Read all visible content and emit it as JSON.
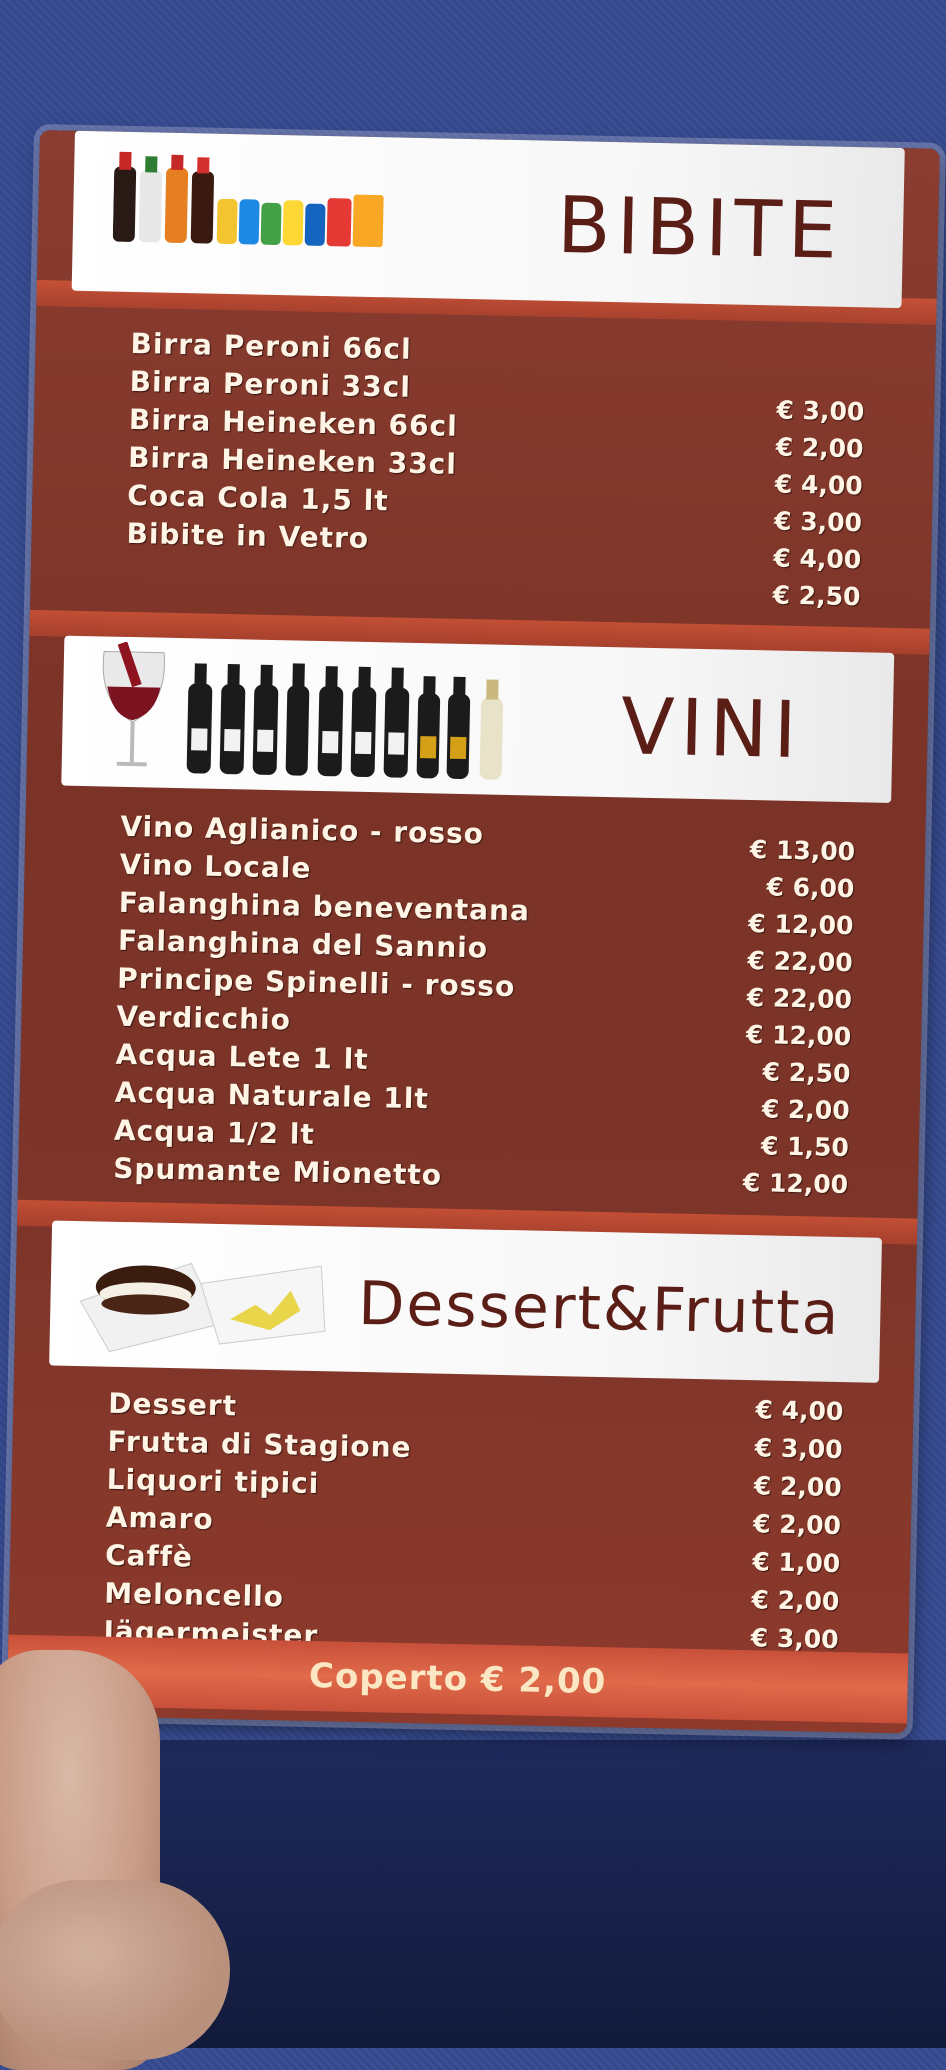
{
  "sections": [
    {
      "title": "BIBITE",
      "items": [
        {
          "name": "Birra Peroni 66cl",
          "price": "€ 3,00"
        },
        {
          "name": "Birra Peroni 33cl",
          "price": "€ 2,00"
        },
        {
          "name": "Birra Heineken 66cl",
          "price": "€ 4,00"
        },
        {
          "name": "Birra Heineken 33cl",
          "price": "€ 3,00"
        },
        {
          "name": "Coca Cola 1,5 lt",
          "price": "€ 4,00"
        },
        {
          "name": "Bibite in Vetro",
          "price": "€ 2,50"
        }
      ]
    },
    {
      "title": "VINI",
      "items": [
        {
          "name": "Vino Aglianico - rosso",
          "price": "€ 13,00"
        },
        {
          "name": "Vino Locale",
          "price": "€  6,00"
        },
        {
          "name": "Falanghina beneventana",
          "price": "€ 12,00"
        },
        {
          "name": "Falanghina del Sannio",
          "price": "€ 22,00"
        },
        {
          "name": "Principe Spinelli - rosso",
          "price": "€ 22,00"
        },
        {
          "name": "Verdicchio",
          "price": "€ 12,00"
        },
        {
          "name": "Acqua Lete 1 lt",
          "price": "€  2,50"
        },
        {
          "name": "Acqua Naturale 1lt",
          "price": "€  2,00"
        },
        {
          "name": "Acqua 1/2 lt",
          "price": "€  1,50"
        },
        {
          "name": "Spumante Mionetto",
          "price": "€ 12,00"
        }
      ]
    },
    {
      "title": "Dessert&Frutta",
      "items": [
        {
          "name": "Dessert",
          "price": "€ 4,00"
        },
        {
          "name": "Frutta di Stagione",
          "price": "€ 3,00"
        },
        {
          "name": "Liquori tipici",
          "price": "€ 2,00"
        },
        {
          "name": "Amaro",
          "price": "€ 2,00"
        },
        {
          "name": "Caffè",
          "price": "€ 1,00"
        },
        {
          "name": "Meloncello",
          "price": "€ 2,00"
        },
        {
          "name": "Jägermeister",
          "price": "€ 3,00"
        }
      ]
    }
  ],
  "footer": {
    "coperto": "Coperto € 2,00"
  },
  "colors": {
    "card": "#7b3327",
    "title": "#5b1e17",
    "text": "#fff5e6",
    "band": "#ffffff"
  },
  "images": [
    "soft-drink-bottles",
    "wine-glass-and-bottles",
    "dessert-plate"
  ]
}
